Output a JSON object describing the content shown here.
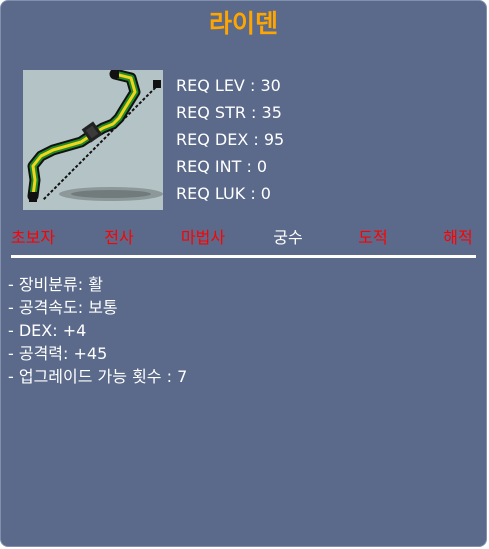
{
  "item": {
    "name": "라이덴",
    "name_color": "#ffa500",
    "icon": "bow-icon"
  },
  "requirements": [
    {
      "label": "REQ LEV",
      "value": "30",
      "text": "REQ LEV : 30"
    },
    {
      "label": "REQ STR",
      "value": "35",
      "text": "REQ STR : 35"
    },
    {
      "label": "REQ DEX",
      "value": "95",
      "text": "REQ DEX : 95"
    },
    {
      "label": "REQ INT",
      "value": "0",
      "text": "REQ INT : 0"
    },
    {
      "label": "REQ LUK",
      "value": "0",
      "text": "REQ LUK : 0"
    }
  ],
  "jobs": [
    {
      "name": "초보자",
      "color": "#ff0000"
    },
    {
      "name": "전사",
      "color": "#ff0000"
    },
    {
      "name": "마법사",
      "color": "#ff0000"
    },
    {
      "name": "궁수",
      "color": "#ffffff"
    },
    {
      "name": "도적",
      "color": "#ff0000"
    },
    {
      "name": "해적",
      "color": "#ff0000"
    }
  ],
  "stats": [
    "- 장비분류: 활",
    "- 공격속도: 보통",
    "- DEX: +4",
    "- 공격력: +45",
    "- 업그레이드 가능 횟수 : 7"
  ],
  "colors": {
    "background": "#5b6a8b",
    "text": "#ffffff",
    "unavailable_job": "#ff0000",
    "available_job": "#ffffff",
    "item_name": "#ffa500"
  }
}
